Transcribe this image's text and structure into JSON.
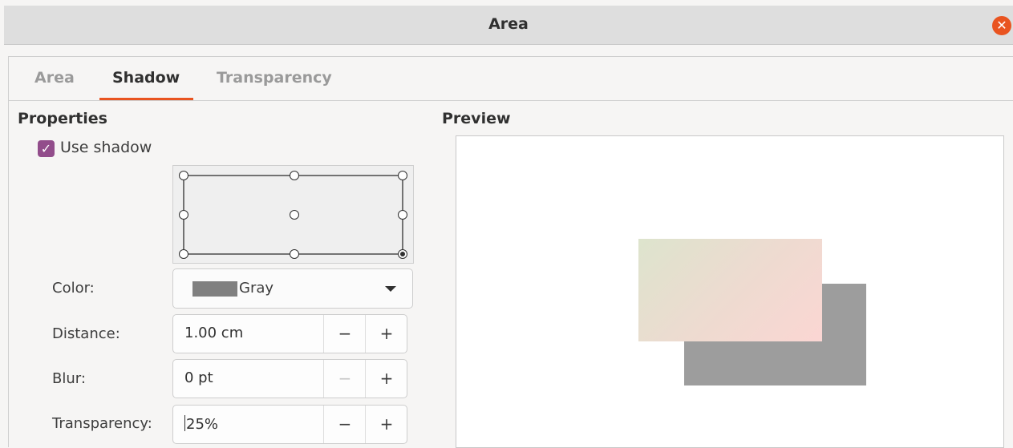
{
  "window": {
    "title": "Area",
    "close_icon": "close-icon",
    "accent": "#e95420"
  },
  "tabs": [
    {
      "label": "Area",
      "active": false
    },
    {
      "label": "Shadow",
      "active": true
    },
    {
      "label": "Transparency",
      "active": false
    }
  ],
  "properties": {
    "heading": "Properties",
    "use_shadow": {
      "label": "Use shadow",
      "checked": true,
      "color": "#924d8b"
    },
    "position": {
      "selected": "bottom-right"
    },
    "color": {
      "label": "Color:",
      "value": "Gray",
      "swatch": "#808080"
    },
    "distance": {
      "label": "Distance:",
      "value": "1.00 cm"
    },
    "blur": {
      "label": "Blur:",
      "value": "0 pt"
    },
    "transparency": {
      "label": "Transparency:",
      "value": "25%"
    }
  },
  "preview": {
    "heading": "Preview",
    "shadow_color": "#9d9d9d"
  }
}
